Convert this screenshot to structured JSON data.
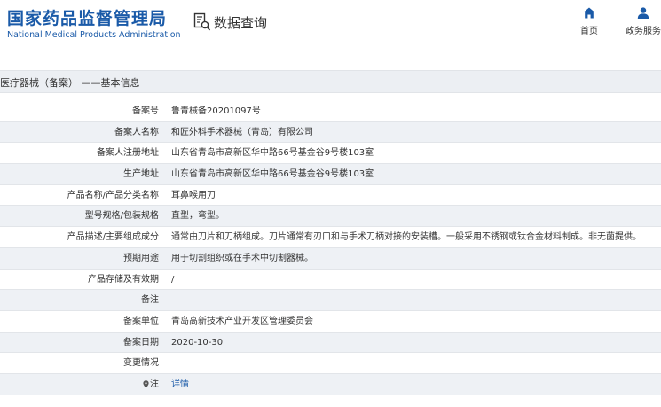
{
  "header": {
    "logo_cn": "国家药品监督管理局",
    "logo_en": "National Medical Products Administration",
    "query_label": "数据查询",
    "nav": [
      {
        "label": "首页",
        "icon": "home-icon"
      },
      {
        "label": "政务服务",
        "icon": "user-icon"
      }
    ]
  },
  "section": {
    "title": "医疗器械（备案） ——基本信息"
  },
  "rows": [
    {
      "label": "备案号",
      "value": "鲁青械备20201097号"
    },
    {
      "label": "备案人名称",
      "value": "和匠外科手术器械（青岛）有限公司"
    },
    {
      "label": "备案人注册地址",
      "value": "山东省青岛市高新区华中路66号基金谷9号楼103室"
    },
    {
      "label": "生产地址",
      "value": "山东省青岛市高新区华中路66号基金谷9号楼103室"
    },
    {
      "label": "产品名称/产品分类名称",
      "value": "耳鼻喉用刀"
    },
    {
      "label": "型号规格/包装规格",
      "value": "直型，弯型。"
    },
    {
      "label": "产品描述/主要组成成分",
      "value": "通常由刀片和刀柄组成。刀片通常有刃口和与手术刀柄对接的安装槽。一般采用不锈钢或钛合金材料制成。非无菌提供。"
    },
    {
      "label": "预期用途",
      "value": "用于切割组织或在手术中切割器械。"
    },
    {
      "label": "产品存储及有效期",
      "value": "/"
    },
    {
      "label": "备注",
      "value": ""
    },
    {
      "label": "备案单位",
      "value": "青岛高新技术产业开发区管理委员会"
    },
    {
      "label": "备案日期",
      "value": "2020-10-30"
    },
    {
      "label": "变更情况",
      "value": ""
    },
    {
      "label": "注",
      "value": "详情"
    }
  ],
  "colors": {
    "brand": "#1a5aa8",
    "row_alt": "#eef1f5",
    "section_bg": "#eceff3"
  }
}
